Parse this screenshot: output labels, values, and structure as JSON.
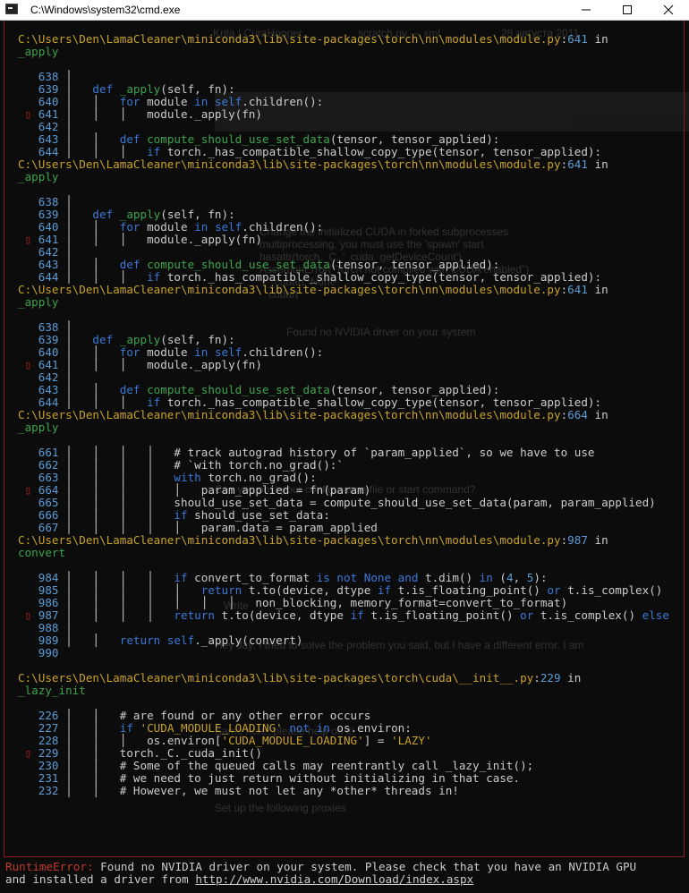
{
  "window": {
    "title": "C:\\Windows\\system32\\cmd.exe",
    "minimize_icon": "minimize-icon",
    "maximize_icon": "maximize-icon",
    "close_icon": "close-icon"
  },
  "background_ghost": [
    "Krita | CuraHopper",
    "scratch.py — xml",
    "28 августа 2011",
    "Change the initialized CUDA in forked subprocesses",
    "multiprocessing, you must use the 'spawn' start",
    "hasattr(torch._C, '_cuda_getDeviceCount')",
    "AssertionError(\"Torch not compiled with CUDA enabled\")",
    "_cudart, None",
    "cudart",
    "Found no NVIDIA driver on your system",
    "Can you post your configuration file or start command?",
    "Write",
    "Hey Jay, I tried to solve the problem you said, but I have a different error. I am",
    "Same here, please help on it!",
    "Set up the following proxies"
  ],
  "colors": {
    "background": "#0c0c0c",
    "path": "#c9a228",
    "line_number": "#5a9bd5",
    "keyword": "#3b78d8",
    "function": "#3fa34d",
    "string": "#c9a228",
    "error": "#c0392b",
    "frame_border": "#8b1a1a"
  },
  "traceback": [
    [
      {
        "c": "path",
        "t": "C:\\Users\\Den\\LamaCleaner\\miniconda3\\lib\\site-packages\\torch\\nn\\modules\\module.py"
      },
      {
        "c": "plain",
        "t": ":"
      },
      {
        "c": "num",
        "t": "641"
      },
      {
        "c": "plain",
        "t": " in"
      }
    ],
    [
      {
        "c": "fn",
        "t": "_apply"
      }
    ],
    [],
    [
      {
        "c": "num",
        "t": "   638"
      },
      {
        "c": "gut",
        "t": " │"
      }
    ],
    [
      {
        "c": "num",
        "t": "   639"
      },
      {
        "c": "gut",
        "t": " │   "
      },
      {
        "c": "kw",
        "t": "def"
      },
      {
        "c": "plain",
        "t": " "
      },
      {
        "c": "fn",
        "t": "_apply"
      },
      {
        "c": "plain",
        "t": "(self, fn):"
      }
    ],
    [
      {
        "c": "num",
        "t": "   640"
      },
      {
        "c": "gut",
        "t": " │   │   "
      },
      {
        "c": "kw",
        "t": "for"
      },
      {
        "c": "plain",
        "t": " module "
      },
      {
        "c": "kw",
        "t": "in"
      },
      {
        "c": "plain",
        "t": " "
      },
      {
        "c": "kw",
        "t": "self"
      },
      {
        "c": "plain",
        "t": ".children():"
      }
    ],
    [
      {
        "c": "mark",
        "t": " ▯ "
      },
      {
        "c": "num",
        "t": "641"
      },
      {
        "c": "gut",
        "t": " │   │   │   "
      },
      {
        "c": "plain",
        "t": "module._apply(fn)"
      }
    ],
    [
      {
        "c": "num",
        "t": "   642"
      },
      {
        "c": "gut",
        "t": " │"
      }
    ],
    [
      {
        "c": "num",
        "t": "   643"
      },
      {
        "c": "gut",
        "t": " │   │   "
      },
      {
        "c": "kw",
        "t": "def"
      },
      {
        "c": "plain",
        "t": " "
      },
      {
        "c": "fn",
        "t": "compute_should_use_set_data"
      },
      {
        "c": "plain",
        "t": "(tensor, tensor_applied):"
      }
    ],
    [
      {
        "c": "num",
        "t": "   644"
      },
      {
        "c": "gut",
        "t": " │   │   │   "
      },
      {
        "c": "kw",
        "t": "if"
      },
      {
        "c": "plain",
        "t": " torch._has_compatible_shallow_copy_type(tensor, tensor_applied):"
      }
    ],
    [
      {
        "c": "path",
        "t": "C:\\Users\\Den\\LamaCleaner\\miniconda3\\lib\\site-packages\\torch\\nn\\modules\\module.py"
      },
      {
        "c": "plain",
        "t": ":"
      },
      {
        "c": "num",
        "t": "641"
      },
      {
        "c": "plain",
        "t": " in"
      }
    ],
    [
      {
        "c": "fn",
        "t": "_apply"
      }
    ],
    [],
    [
      {
        "c": "num",
        "t": "   638"
      },
      {
        "c": "gut",
        "t": " │"
      }
    ],
    [
      {
        "c": "num",
        "t": "   639"
      },
      {
        "c": "gut",
        "t": " │   "
      },
      {
        "c": "kw",
        "t": "def"
      },
      {
        "c": "plain",
        "t": " "
      },
      {
        "c": "fn",
        "t": "_apply"
      },
      {
        "c": "plain",
        "t": "(self, fn):"
      }
    ],
    [
      {
        "c": "num",
        "t": "   640"
      },
      {
        "c": "gut",
        "t": " │   │   "
      },
      {
        "c": "kw",
        "t": "for"
      },
      {
        "c": "plain",
        "t": " module "
      },
      {
        "c": "kw",
        "t": "in"
      },
      {
        "c": "plain",
        "t": " "
      },
      {
        "c": "kw",
        "t": "self"
      },
      {
        "c": "plain",
        "t": ".children():"
      }
    ],
    [
      {
        "c": "mark",
        "t": " ▯ "
      },
      {
        "c": "num",
        "t": "641"
      },
      {
        "c": "gut",
        "t": " │   │   │   "
      },
      {
        "c": "plain",
        "t": "module._apply(fn)"
      }
    ],
    [
      {
        "c": "num",
        "t": "   642"
      },
      {
        "c": "gut",
        "t": " │"
      }
    ],
    [
      {
        "c": "num",
        "t": "   643"
      },
      {
        "c": "gut",
        "t": " │   │   "
      },
      {
        "c": "kw",
        "t": "def"
      },
      {
        "c": "plain",
        "t": " "
      },
      {
        "c": "fn",
        "t": "compute_should_use_set_data"
      },
      {
        "c": "plain",
        "t": "(tensor, tensor_applied):"
      }
    ],
    [
      {
        "c": "num",
        "t": "   644"
      },
      {
        "c": "gut",
        "t": " │   │   │   "
      },
      {
        "c": "kw",
        "t": "if"
      },
      {
        "c": "plain",
        "t": " torch._has_compatible_shallow_copy_type(tensor, tensor_applied):"
      }
    ],
    [
      {
        "c": "path",
        "t": "C:\\Users\\Den\\LamaCleaner\\miniconda3\\lib\\site-packages\\torch\\nn\\modules\\module.py"
      },
      {
        "c": "plain",
        "t": ":"
      },
      {
        "c": "num",
        "t": "641"
      },
      {
        "c": "plain",
        "t": " in"
      }
    ],
    [
      {
        "c": "fn",
        "t": "_apply"
      }
    ],
    [],
    [
      {
        "c": "num",
        "t": "   638"
      },
      {
        "c": "gut",
        "t": " │"
      }
    ],
    [
      {
        "c": "num",
        "t": "   639"
      },
      {
        "c": "gut",
        "t": " │   "
      },
      {
        "c": "kw",
        "t": "def"
      },
      {
        "c": "plain",
        "t": " "
      },
      {
        "c": "fn",
        "t": "_apply"
      },
      {
        "c": "plain",
        "t": "(self, fn):"
      }
    ],
    [
      {
        "c": "num",
        "t": "   640"
      },
      {
        "c": "gut",
        "t": " │   │   "
      },
      {
        "c": "kw",
        "t": "for"
      },
      {
        "c": "plain",
        "t": " module "
      },
      {
        "c": "kw",
        "t": "in"
      },
      {
        "c": "plain",
        "t": " "
      },
      {
        "c": "kw",
        "t": "self"
      },
      {
        "c": "plain",
        "t": ".children():"
      }
    ],
    [
      {
        "c": "mark",
        "t": " ▯ "
      },
      {
        "c": "num",
        "t": "641"
      },
      {
        "c": "gut",
        "t": " │   │   │   "
      },
      {
        "c": "plain",
        "t": "module._apply(fn)"
      }
    ],
    [
      {
        "c": "num",
        "t": "   642"
      },
      {
        "c": "gut",
        "t": " │"
      }
    ],
    [
      {
        "c": "num",
        "t": "   643"
      },
      {
        "c": "gut",
        "t": " │   │   "
      },
      {
        "c": "kw",
        "t": "def"
      },
      {
        "c": "plain",
        "t": " "
      },
      {
        "c": "fn",
        "t": "compute_should_use_set_data"
      },
      {
        "c": "plain",
        "t": "(tensor, tensor_applied):"
      }
    ],
    [
      {
        "c": "num",
        "t": "   644"
      },
      {
        "c": "gut",
        "t": " │   │   │   "
      },
      {
        "c": "kw",
        "t": "if"
      },
      {
        "c": "plain",
        "t": " torch._has_compatible_shallow_copy_type(tensor, tensor_applied):"
      }
    ],
    [
      {
        "c": "path",
        "t": "C:\\Users\\Den\\LamaCleaner\\miniconda3\\lib\\site-packages\\torch\\nn\\modules\\module.py"
      },
      {
        "c": "plain",
        "t": ":"
      },
      {
        "c": "num",
        "t": "664"
      },
      {
        "c": "plain",
        "t": " in"
      }
    ],
    [
      {
        "c": "fn",
        "t": "_apply"
      }
    ],
    [],
    [
      {
        "c": "num",
        "t": "   661"
      },
      {
        "c": "gut",
        "t": " │   │   │   │   "
      },
      {
        "c": "plain",
        "t": "# track autograd history of `param_applied`, so we have to use"
      }
    ],
    [
      {
        "c": "num",
        "t": "   662"
      },
      {
        "c": "gut",
        "t": " │   │   │   │   "
      },
      {
        "c": "plain",
        "t": "# `with torch.no_grad():`"
      }
    ],
    [
      {
        "c": "num",
        "t": "   663"
      },
      {
        "c": "gut",
        "t": " │   │   │   │   "
      },
      {
        "c": "kw",
        "t": "with"
      },
      {
        "c": "plain",
        "t": " torch.no_grad():"
      }
    ],
    [
      {
        "c": "mark",
        "t": " ▯ "
      },
      {
        "c": "num",
        "t": "664"
      },
      {
        "c": "gut",
        "t": " │   │   │   │   │   "
      },
      {
        "c": "plain",
        "t": "param_applied = fn(param)"
      }
    ],
    [
      {
        "c": "num",
        "t": "   665"
      },
      {
        "c": "gut",
        "t": " │   │   │   │   "
      },
      {
        "c": "plain",
        "t": "should_use_set_data = compute_should_use_set_data(param, param_applied)"
      }
    ],
    [
      {
        "c": "num",
        "t": "   666"
      },
      {
        "c": "gut",
        "t": " │   │   │   │   "
      },
      {
        "c": "kw",
        "t": "if"
      },
      {
        "c": "plain",
        "t": " should_use_set_data:"
      }
    ],
    [
      {
        "c": "num",
        "t": "   667"
      },
      {
        "c": "gut",
        "t": " │   │   │   │   │   "
      },
      {
        "c": "plain",
        "t": "param.data = param_applied"
      }
    ],
    [
      {
        "c": "path",
        "t": "C:\\Users\\Den\\LamaCleaner\\miniconda3\\lib\\site-packages\\torch\\nn\\modules\\module.py"
      },
      {
        "c": "plain",
        "t": ":"
      },
      {
        "c": "num",
        "t": "987"
      },
      {
        "c": "plain",
        "t": " in"
      }
    ],
    [
      {
        "c": "fn",
        "t": "convert"
      }
    ],
    [],
    [
      {
        "c": "num",
        "t": "   984"
      },
      {
        "c": "gut",
        "t": " │   │   │   │   "
      },
      {
        "c": "kw",
        "t": "if"
      },
      {
        "c": "plain",
        "t": " convert_to_format "
      },
      {
        "c": "kw",
        "t": "is not"
      },
      {
        "c": "plain",
        "t": " "
      },
      {
        "c": "kw",
        "t": "None"
      },
      {
        "c": "plain",
        "t": " "
      },
      {
        "c": "kw",
        "t": "and"
      },
      {
        "c": "plain",
        "t": " t.dim() "
      },
      {
        "c": "kw",
        "t": "in"
      },
      {
        "c": "plain",
        "t": " ("
      },
      {
        "c": "num",
        "t": "4"
      },
      {
        "c": "plain",
        "t": ", "
      },
      {
        "c": "num",
        "t": "5"
      },
      {
        "c": "plain",
        "t": "):"
      }
    ],
    [
      {
        "c": "num",
        "t": "   985"
      },
      {
        "c": "gut",
        "t": " │   │   │   │   │   "
      },
      {
        "c": "kw",
        "t": "return"
      },
      {
        "c": "plain",
        "t": " t.to(device, dtype "
      },
      {
        "c": "kw",
        "t": "if"
      },
      {
        "c": "plain",
        "t": " t.is_floating_point() "
      },
      {
        "c": "kw",
        "t": "or"
      },
      {
        "c": "plain",
        "t": " t.is_complex()"
      }
    ],
    [
      {
        "c": "num",
        "t": "   986"
      },
      {
        "c": "gut",
        "t": " │   │   │   │   │   │   │   "
      },
      {
        "c": "plain",
        "t": "non_blocking, memory_format=convert_to_format)"
      }
    ],
    [
      {
        "c": "mark",
        "t": " ▯ "
      },
      {
        "c": "num",
        "t": "987"
      },
      {
        "c": "gut",
        "t": " │   │   │   │   "
      },
      {
        "c": "kw",
        "t": "return"
      },
      {
        "c": "plain",
        "t": " t.to(device, dtype "
      },
      {
        "c": "kw",
        "t": "if"
      },
      {
        "c": "plain",
        "t": " t.is_floating_point() "
      },
      {
        "c": "kw",
        "t": "or"
      },
      {
        "c": "plain",
        "t": " t.is_complex() "
      },
      {
        "c": "kw",
        "t": "else"
      }
    ],
    [
      {
        "c": "num",
        "t": "   988"
      },
      {
        "c": "gut",
        "t": " │"
      }
    ],
    [
      {
        "c": "num",
        "t": "   989"
      },
      {
        "c": "gut",
        "t": " │   │   "
      },
      {
        "c": "kw",
        "t": "return"
      },
      {
        "c": "plain",
        "t": " "
      },
      {
        "c": "kw",
        "t": "self"
      },
      {
        "c": "plain",
        "t": "._apply(convert)"
      }
    ],
    [
      {
        "c": "num",
        "t": "   990"
      }
    ],
    [],
    [
      {
        "c": "path",
        "t": "C:\\Users\\Den\\LamaCleaner\\miniconda3\\lib\\site-packages\\torch\\cuda\\__init__.py"
      },
      {
        "c": "plain",
        "t": ":"
      },
      {
        "c": "num",
        "t": "229"
      },
      {
        "c": "plain",
        "t": " in"
      }
    ],
    [
      {
        "c": "fn",
        "t": "_lazy_init"
      }
    ],
    [],
    [
      {
        "c": "num",
        "t": "   226"
      },
      {
        "c": "gut",
        "t": " │   │   "
      },
      {
        "c": "plain",
        "t": "# are found or any other error occurs"
      }
    ],
    [
      {
        "c": "num",
        "t": "   227"
      },
      {
        "c": "gut",
        "t": " │   │   "
      },
      {
        "c": "kw",
        "t": "if"
      },
      {
        "c": "plain",
        "t": " "
      },
      {
        "c": "str",
        "t": "'CUDA_MODULE_LOADING'"
      },
      {
        "c": "plain",
        "t": " "
      },
      {
        "c": "kw",
        "t": "not in"
      },
      {
        "c": "plain",
        "t": " os.environ:"
      }
    ],
    [
      {
        "c": "num",
        "t": "   228"
      },
      {
        "c": "gut",
        "t": " │   │   │   "
      },
      {
        "c": "plain",
        "t": "os.environ["
      },
      {
        "c": "str",
        "t": "'CUDA_MODULE_LOADING'"
      },
      {
        "c": "plain",
        "t": "] = "
      },
      {
        "c": "str",
        "t": "'LAZY'"
      }
    ],
    [
      {
        "c": "mark",
        "t": " ▯ "
      },
      {
        "c": "num",
        "t": "229"
      },
      {
        "c": "gut",
        "t": " │   │   "
      },
      {
        "c": "plain",
        "t": "torch._C._cuda_init()"
      }
    ],
    [
      {
        "c": "num",
        "t": "   230"
      },
      {
        "c": "gut",
        "t": " │   │   "
      },
      {
        "c": "plain",
        "t": "# Some of the queued calls may reentrantly call _lazy_init();"
      }
    ],
    [
      {
        "c": "num",
        "t": "   231"
      },
      {
        "c": "gut",
        "t": " │   │   "
      },
      {
        "c": "plain",
        "t": "# we need to just return without initializing in that case."
      }
    ],
    [
      {
        "c": "num",
        "t": "   232"
      },
      {
        "c": "gut",
        "t": " │   │   "
      },
      {
        "c": "plain",
        "t": "# However, we must not let any *other* threads in!"
      }
    ]
  ],
  "error": {
    "type": "RuntimeError:",
    "message": " Found no NVIDIA driver on your system. Please check that you have an NVIDIA GPU",
    "message2": "and installed a driver from ",
    "link": "http://www.nvidia.com/Download/index.aspx"
  }
}
